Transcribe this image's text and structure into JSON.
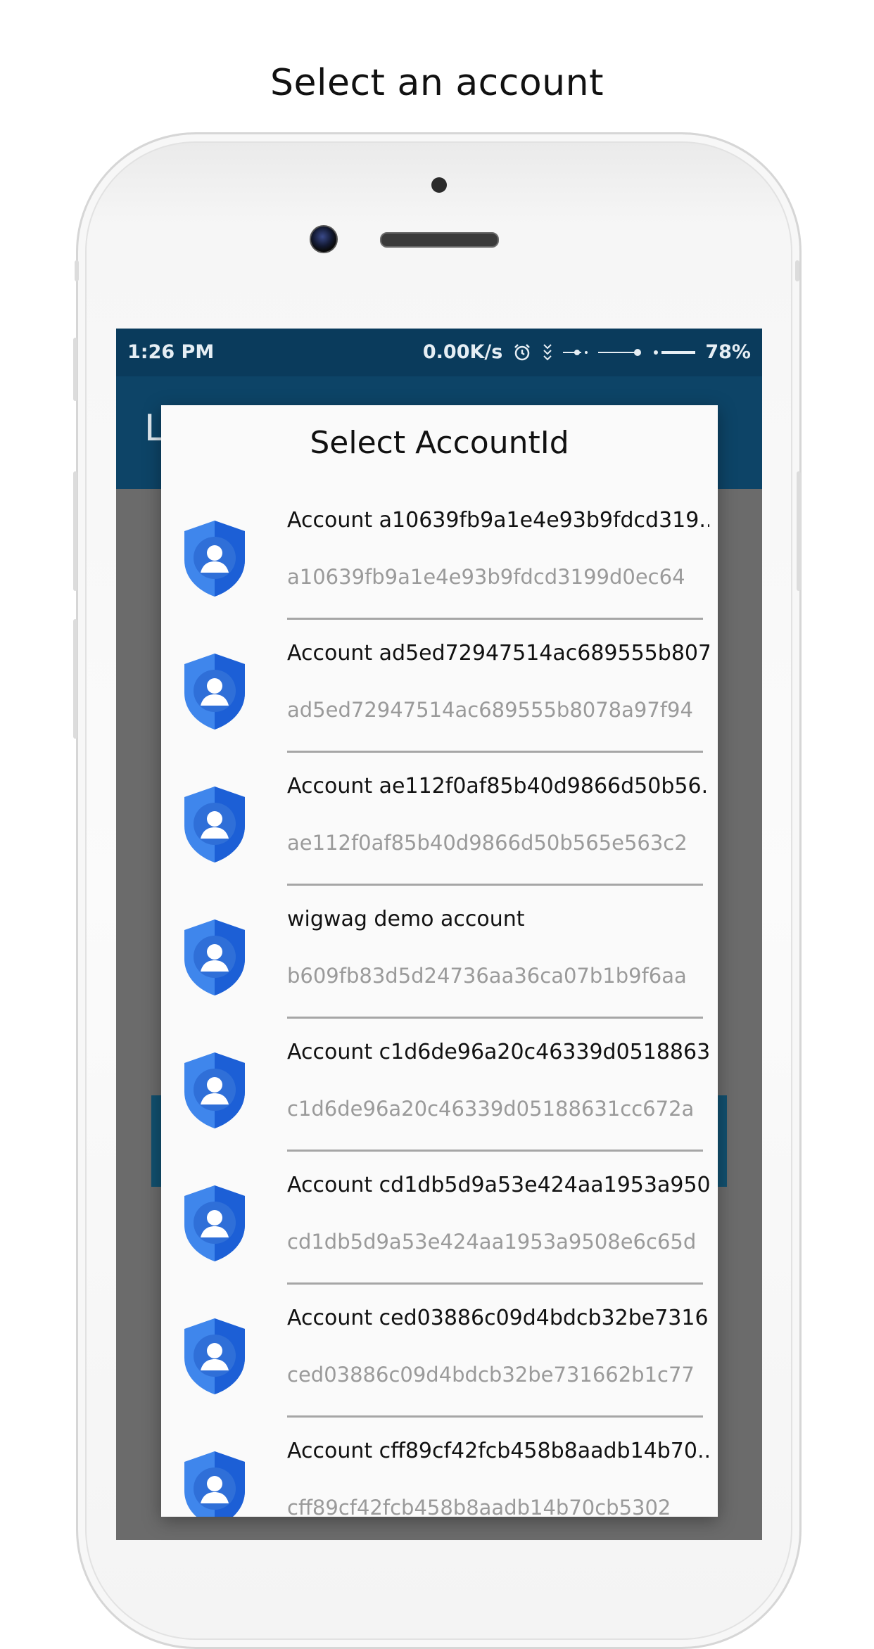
{
  "caption": "Select an account",
  "status_bar": {
    "time": "1:26 PM",
    "speed": "0.00K/s",
    "battery": "78%"
  },
  "app_bar": {
    "title_fragment": "L"
  },
  "dialog": {
    "title": "Select AccountId",
    "accounts": [
      {
        "name": "Account a10639fb9a1e4e93b9fdcd319...",
        "id": "a10639fb9a1e4e93b9fdcd3199d0ec64"
      },
      {
        "name": "Account ad5ed72947514ac689555b807...",
        "id": "ad5ed72947514ac689555b8078a97f94"
      },
      {
        "name": "Account ae112f0af85b40d9866d50b56...",
        "id": "ae112f0af85b40d9866d50b565e563c2"
      },
      {
        "name": "wigwag demo account",
        "id": "b609fb83d5d24736aa36ca07b1b9f6aa"
      },
      {
        "name": "Account c1d6de96a20c46339d0518863...",
        "id": "c1d6de96a20c46339d05188631cc672a"
      },
      {
        "name": "Account cd1db5d9a53e424aa1953a950...",
        "id": "cd1db5d9a53e424aa1953a9508e6c65d"
      },
      {
        "name": "Account ced03886c09d4bdcb32be7316...",
        "id": "ced03886c09d4bdcb32be731662b1c77"
      },
      {
        "name": "Account cff89cf42fcb458b8aadb14b70...",
        "id": "cff89cf42fcb458b8aadb14b70cb5302"
      }
    ]
  },
  "colors": {
    "status_bar": "#0a3b5c",
    "app_bar": "#0d4467",
    "shield_light": "#3f86ec",
    "shield_dark": "#1c5fd6"
  }
}
